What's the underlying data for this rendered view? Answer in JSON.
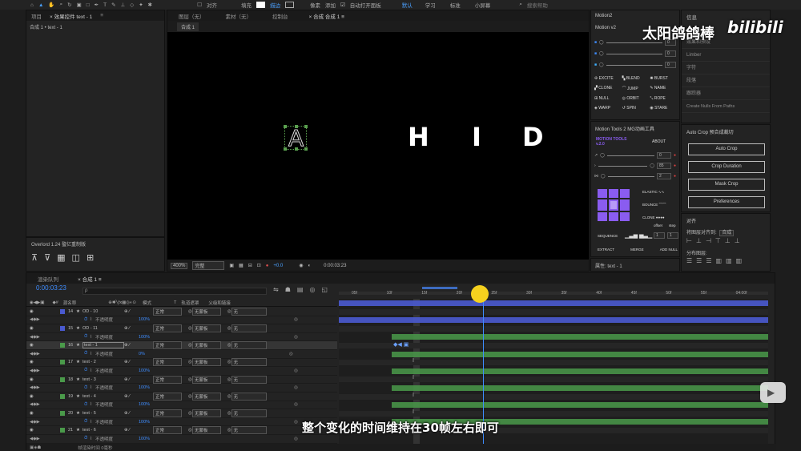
{
  "toolbar": {
    "snap_label": "对齐",
    "fill_label": "填充",
    "stroke_label": "描边",
    "px_label": "像素",
    "add_label": "添加",
    "auto_open_label": "自动打开面板",
    "workspaces": [
      "默认",
      "学习",
      "标准",
      "小屏幕"
    ],
    "search_placeholder": "搜索帮助"
  },
  "project_panel": {
    "tabs": [
      "项目",
      "效果控件 text - 1"
    ],
    "breadcrumb": "合成 1 • text - 1"
  },
  "viewer": {
    "tabs": [
      "图层（无）",
      "素材（无）",
      "控制台",
      "合成 合成 1"
    ],
    "sub_tab": "合成 1",
    "letters": [
      "A",
      "H",
      "I",
      "D"
    ],
    "zoom": "400%",
    "quality": "完整",
    "exposure": "+0.0",
    "timecode": "0:00:03:23"
  },
  "overlord_panel": {
    "title": "Overlord 1.24 螯亿重制版"
  },
  "motion2": {
    "title": "Motion2",
    "subtitle": "Motion v2",
    "values": [
      "0",
      "0",
      "0"
    ],
    "buttons": [
      "EXCITE",
      "BLEND",
      "BURST",
      "CLONE",
      "JUMP",
      "NAME",
      "NULL",
      "ORBIT",
      "ROPE",
      "WARP",
      "SPIN",
      "STARE"
    ]
  },
  "motion_tools": {
    "title": "Motion Tools 2 MG动画工具",
    "logo": "MOTION TOOLS v.2.0",
    "about": "ABOUT",
    "values": [
      "0",
      "85",
      "2"
    ],
    "labels": [
      "ELASTIC",
      "BOUNCE",
      "CLONE"
    ],
    "sequence": "SEQUENCE",
    "offset": "offset",
    "step": "step",
    "offset_val": "1",
    "step_val": "1",
    "bottom_buttons": [
      "EXTRACT",
      "MERGE",
      "ADD NULL"
    ]
  },
  "properties": {
    "label": "属性: text - 1"
  },
  "info_panel": {
    "title": "信息",
    "items": [
      "音频",
      "效果和预设",
      "Limber",
      "字符",
      "段落",
      "跟踪器",
      "Create Nulls From Paths"
    ]
  },
  "auto_crop": {
    "title": "Auto Crop 预合成裁切",
    "buttons": [
      "Auto Crop",
      "Crop Duration",
      "Mask Crop",
      "Preferences"
    ]
  },
  "align_panel": {
    "title": "对齐",
    "align_to_label": "将图层对齐到:",
    "align_to_value": "合成",
    "distribute_label": "分布图层:"
  },
  "timeline": {
    "tabs": [
      "渲染队列",
      "合成 1"
    ],
    "timecode": "0:00:03:23",
    "search_placeholder": "ρ",
    "columns": [
      "源名称",
      "模式",
      "T",
      "轨道遮罩",
      "父级和链接"
    ],
    "ruler_ticks": [
      "05f",
      "10f",
      "15f",
      "20f",
      "25f",
      "30f",
      "35f",
      "40f",
      "45f",
      "50f",
      "55f",
      "04:00f"
    ],
    "rows": [
      {
        "num": "14",
        "name": "OD - 10",
        "mode": "正常",
        "matte": "无蒙板",
        "parent": "无",
        "opacity_label": "不透明度",
        "opacity": "100%"
      },
      {
        "num": "15",
        "name": "OD - 11",
        "mode": "正常",
        "matte": "无蒙板",
        "parent": "无",
        "opacity_label": "不透明度",
        "opacity": "100%"
      },
      {
        "num": "16",
        "name": "text - 1",
        "mode": "正常",
        "matte": "无蒙板",
        "parent": "无",
        "opacity_label": "不透明度",
        "opacity": "0%"
      },
      {
        "num": "17",
        "name": "text - 2",
        "mode": "正常",
        "matte": "无蒙板",
        "parent": "无",
        "opacity_label": "不透明度",
        "opacity": "100%"
      },
      {
        "num": "18",
        "name": "text - 3",
        "mode": "正常",
        "matte": "无蒙板",
        "parent": "无",
        "opacity_label": "不透明度",
        "opacity": "100%"
      },
      {
        "num": "19",
        "name": "text - 4",
        "mode": "正常",
        "matte": "无蒙板",
        "parent": "无",
        "opacity_label": "不透明度",
        "opacity": "100%"
      },
      {
        "num": "20",
        "name": "text - 5",
        "mode": "正常",
        "matte": "无蒙板",
        "parent": "无",
        "opacity_label": "不透明度",
        "opacity": "100%"
      },
      {
        "num": "21",
        "name": "text - 6",
        "mode": "正常",
        "matte": "无蒙板",
        "parent": "无",
        "opacity_label": "不透明度",
        "opacity": "100%"
      }
    ],
    "footer": "帧渲染时间 0毫秒"
  },
  "watermark": {
    "channel": "太阳鸽鸽棒",
    "brand": "bilibili"
  },
  "subtitle": "整个变化的时间维持在30帧左右即可",
  "colors": {
    "accent_blue": "#3d8cff",
    "playhead": "#f5d11e",
    "label_blue": "#4a5ad0",
    "label_green": "#4a9a4a",
    "motion_purple": "#8a5cf0"
  }
}
